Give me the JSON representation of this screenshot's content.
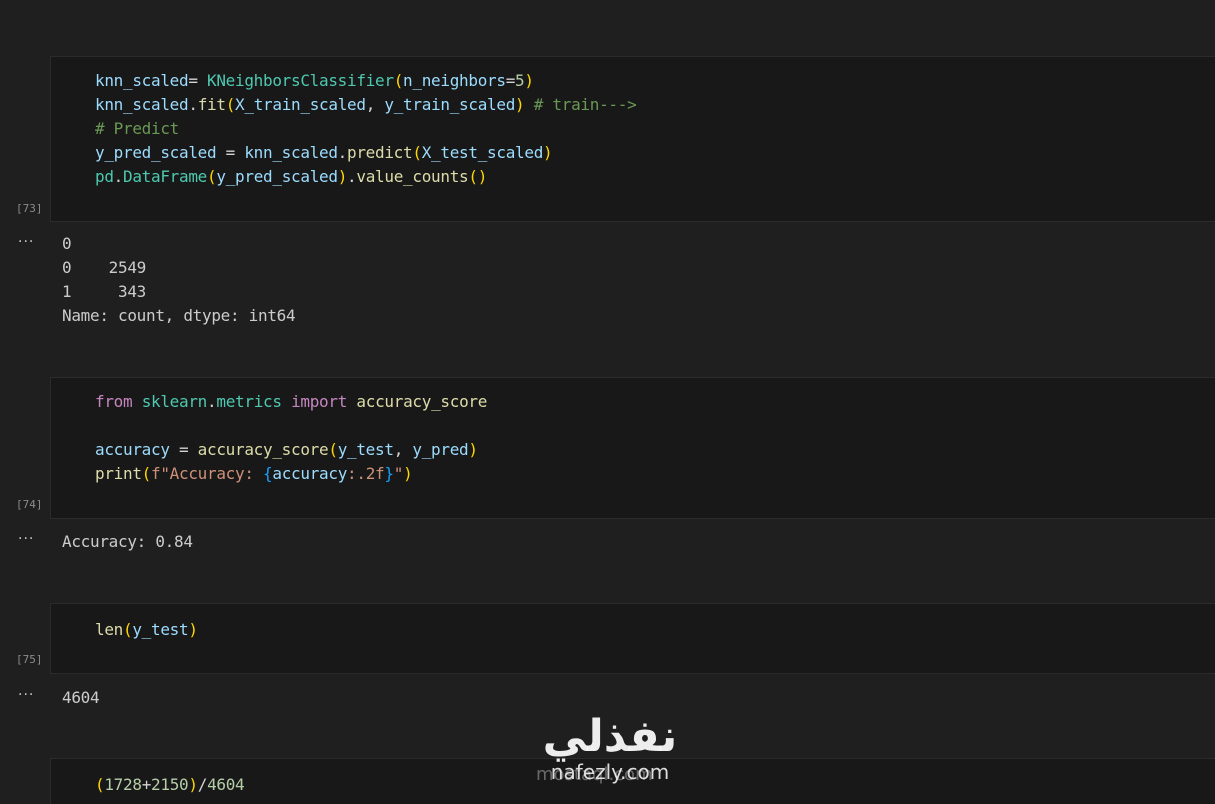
{
  "cells": [
    {
      "exec_count": "[73]",
      "lines": [
        [
          [
            "var",
            "knn_scaled"
          ],
          [
            "op",
            "= "
          ],
          [
            "cls",
            "KNeighborsClassifier"
          ],
          [
            "br1",
            "("
          ],
          [
            "var",
            "n_neighbors"
          ],
          [
            "op",
            "="
          ],
          [
            "num",
            "5"
          ],
          [
            "br1",
            ")"
          ]
        ],
        [
          [
            "var",
            "knn_scaled"
          ],
          [
            "op",
            "."
          ],
          [
            "fn",
            "fit"
          ],
          [
            "br1",
            "("
          ],
          [
            "var",
            "X_train_scaled"
          ],
          [
            "op",
            ", "
          ],
          [
            "var",
            "y_train_scaled"
          ],
          [
            "br1",
            ")"
          ],
          [
            "op",
            " "
          ],
          [
            "cmt",
            "# train--->"
          ]
        ],
        [
          [
            "cmt",
            "# Predict"
          ]
        ],
        [
          [
            "var",
            "y_pred_scaled"
          ],
          [
            "op",
            " = "
          ],
          [
            "var",
            "knn_scaled"
          ],
          [
            "op",
            "."
          ],
          [
            "fn",
            "predict"
          ],
          [
            "br1",
            "("
          ],
          [
            "var",
            "X_test_scaled"
          ],
          [
            "br1",
            ")"
          ]
        ],
        [
          [
            "cls",
            "pd"
          ],
          [
            "op",
            "."
          ],
          [
            "cls",
            "DataFrame"
          ],
          [
            "br1",
            "("
          ],
          [
            "var",
            "y_pred_scaled"
          ],
          [
            "br1",
            ")"
          ],
          [
            "op",
            "."
          ],
          [
            "fn",
            "value_counts"
          ],
          [
            "br1",
            "("
          ],
          [
            "br1",
            ")"
          ]
        ]
      ],
      "output": "0\n0    2549\n1     343\nName: count, dtype: int64"
    },
    {
      "exec_count": "[74]",
      "lines": [
        [
          [
            "kw",
            "from"
          ],
          [
            "op",
            " "
          ],
          [
            "cls",
            "sklearn"
          ],
          [
            "op",
            "."
          ],
          [
            "cls",
            "metrics"
          ],
          [
            "op",
            " "
          ],
          [
            "kw",
            "import"
          ],
          [
            "op",
            " "
          ],
          [
            "fn",
            "accuracy_score"
          ]
        ],
        [],
        [
          [
            "var",
            "accuracy"
          ],
          [
            "op",
            " = "
          ],
          [
            "fn",
            "accuracy_score"
          ],
          [
            "br1",
            "("
          ],
          [
            "var",
            "y_test"
          ],
          [
            "op",
            ", "
          ],
          [
            "var",
            "y_pred"
          ],
          [
            "br1",
            ")"
          ]
        ],
        [
          [
            "fn",
            "print"
          ],
          [
            "br1",
            "("
          ],
          [
            "str",
            "f\"Accuracy: "
          ],
          [
            "br3",
            "{"
          ],
          [
            "var",
            "accuracy"
          ],
          [
            "str",
            ":.2f"
          ],
          [
            "br3",
            "}"
          ],
          [
            "str",
            "\""
          ],
          [
            "br1",
            ")"
          ]
        ]
      ],
      "output": "Accuracy: 0.84"
    },
    {
      "exec_count": "[75]",
      "lines": [
        [
          [
            "fn",
            "len"
          ],
          [
            "br1",
            "("
          ],
          [
            "var",
            "y_test"
          ],
          [
            "br1",
            ")"
          ]
        ]
      ],
      "output": "4604"
    },
    {
      "exec_count": "",
      "lines": [
        [
          [
            "br1",
            "("
          ],
          [
            "num",
            "1728"
          ],
          [
            "op",
            "+"
          ],
          [
            "num",
            "2150"
          ],
          [
            "br1",
            ")"
          ],
          [
            "op",
            "/"
          ],
          [
            "num",
            "4604"
          ]
        ]
      ],
      "output": ""
    }
  ],
  "output_menu_label": "···",
  "watermark": {
    "arabic": "نفذلي",
    "line1": "nafezly.com",
    "line2": "mostaql.com"
  }
}
